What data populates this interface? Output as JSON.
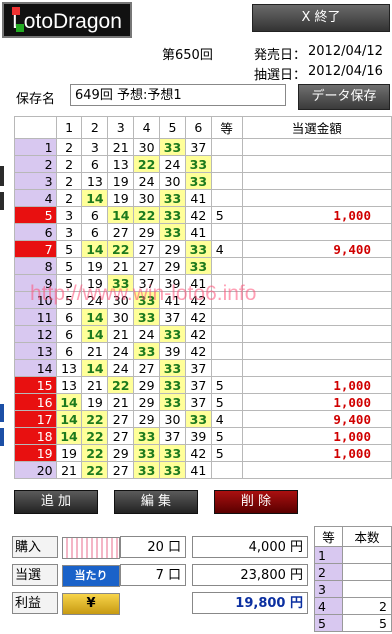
{
  "header": {
    "logo_text": "LotoDragon",
    "close_label": "X 終了",
    "round_title": "第650回",
    "sale_label": "発売日：",
    "sale_date": "2012/04/12",
    "draw_label": "抽選日：",
    "draw_date": "2012/04/16"
  },
  "save": {
    "label": "保存名",
    "value": "649回 予想:予想1",
    "button_label": "データ保存"
  },
  "table": {
    "columns": [
      "",
      "1",
      "2",
      "3",
      "4",
      "5",
      "6",
      "等",
      "当選金額"
    ],
    "rows": [
      {
        "n": "1",
        "nums": [
          "2",
          "3",
          "21",
          "30",
          "33",
          "37"
        ],
        "hl": [
          4
        ],
        "rank": "",
        "prize": ""
      },
      {
        "n": "2",
        "nums": [
          "2",
          "6",
          "13",
          "22",
          "24",
          "33"
        ],
        "hl": [
          3,
          5
        ],
        "rank": "",
        "prize": ""
      },
      {
        "n": "3",
        "nums": [
          "2",
          "13",
          "19",
          "24",
          "30",
          "33"
        ],
        "hl": [
          5
        ],
        "rank": "",
        "prize": ""
      },
      {
        "n": "4",
        "nums": [
          "2",
          "14",
          "19",
          "30",
          "33",
          "41"
        ],
        "hl": [
          1,
          4
        ],
        "rank": "",
        "prize": ""
      },
      {
        "n": "5",
        "nums": [
          "3",
          "6",
          "14",
          "22",
          "33",
          "42"
        ],
        "hl": [
          2,
          3,
          4
        ],
        "rank": "5",
        "prize": "1,000"
      },
      {
        "n": "6",
        "nums": [
          "3",
          "6",
          "27",
          "29",
          "33",
          "41"
        ],
        "hl": [
          4
        ],
        "rank": "",
        "prize": ""
      },
      {
        "n": "7",
        "nums": [
          "5",
          "14",
          "22",
          "27",
          "29",
          "33"
        ],
        "hl": [
          1,
          2,
          5
        ],
        "rank": "4",
        "prize": "9,400"
      },
      {
        "n": "8",
        "nums": [
          "5",
          "19",
          "21",
          "27",
          "29",
          "33"
        ],
        "hl": [
          5
        ],
        "rank": "",
        "prize": ""
      },
      {
        "n": "9",
        "nums": [
          "5",
          "19",
          "33",
          "37",
          "39",
          "41"
        ],
        "hl": [
          2
        ],
        "rank": "",
        "prize": ""
      },
      {
        "n": "10",
        "nums": [
          "5",
          "24",
          "30",
          "33",
          "41",
          "42"
        ],
        "hl": [
          3
        ],
        "rank": "",
        "prize": ""
      },
      {
        "n": "11",
        "nums": [
          "6",
          "14",
          "30",
          "33",
          "37",
          "42"
        ],
        "hl": [
          1,
          3
        ],
        "rank": "",
        "prize": ""
      },
      {
        "n": "12",
        "nums": [
          "6",
          "14",
          "21",
          "24",
          "33",
          "42"
        ],
        "hl": [
          1,
          4
        ],
        "rank": "",
        "prize": ""
      },
      {
        "n": "13",
        "nums": [
          "6",
          "21",
          "24",
          "33",
          "39",
          "42"
        ],
        "hl": [
          3
        ],
        "rank": "",
        "prize": ""
      },
      {
        "n": "14",
        "nums": [
          "13",
          "14",
          "24",
          "27",
          "33",
          "37"
        ],
        "hl": [
          1,
          4
        ],
        "rank": "",
        "prize": ""
      },
      {
        "n": "15",
        "nums": [
          "13",
          "21",
          "22",
          "29",
          "33",
          "37"
        ],
        "hl": [
          2,
          4
        ],
        "rank": "5",
        "prize": "1,000"
      },
      {
        "n": "16",
        "nums": [
          "14",
          "19",
          "21",
          "29",
          "33",
          "37"
        ],
        "hl": [
          0,
          4
        ],
        "rank": "5",
        "prize": "1,000"
      },
      {
        "n": "17",
        "nums": [
          "14",
          "22",
          "27",
          "29",
          "30",
          "33"
        ],
        "hl": [
          0,
          1,
          5
        ],
        "rank": "4",
        "prize": "9,400"
      },
      {
        "n": "18",
        "nums": [
          "14",
          "22",
          "27",
          "33",
          "37",
          "39"
        ],
        "hl": [
          0,
          1,
          3
        ],
        "rank": "5",
        "prize": "1,000"
      },
      {
        "n": "19",
        "nums": [
          "19",
          "22",
          "29",
          "33",
          "33",
          "42"
        ],
        "hl": [
          1,
          3,
          4
        ],
        "rank": "5",
        "prize": "1,000"
      },
      {
        "n": "20",
        "nums": [
          "21",
          "22",
          "27",
          "33",
          "33",
          "41"
        ],
        "hl": [
          1,
          3,
          4
        ],
        "rank": "",
        "prize": ""
      }
    ]
  },
  "buttons": {
    "add": "追 加",
    "edit": "編 集",
    "delete": "削 除"
  },
  "summary": {
    "purchase_label": "購入",
    "purchase_qty": "20 口",
    "purchase_amount": "4,000 円",
    "win_label": "当選",
    "win_badge": "当たり",
    "win_qty": "7 口",
    "win_amount": "23,800 円",
    "profit_label": "利益",
    "profit_badge": "¥",
    "profit_amount": "19,800 円"
  },
  "rank_counts": {
    "headers": [
      "等",
      "本数"
    ],
    "rows": [
      {
        "rank": "1",
        "count": ""
      },
      {
        "rank": "2",
        "count": ""
      },
      {
        "rank": "3",
        "count": ""
      },
      {
        "rank": "4",
        "count": "2"
      },
      {
        "rank": "5",
        "count": "5"
      }
    ]
  },
  "watermark": "http://www.win-loto6.info",
  "colors": {
    "highlight_bg": "#ffff99",
    "hit_number": "#1d7a1d",
    "winning_row": "#e81010",
    "row_index": "#d8c8f0",
    "prize": "#d00000"
  }
}
